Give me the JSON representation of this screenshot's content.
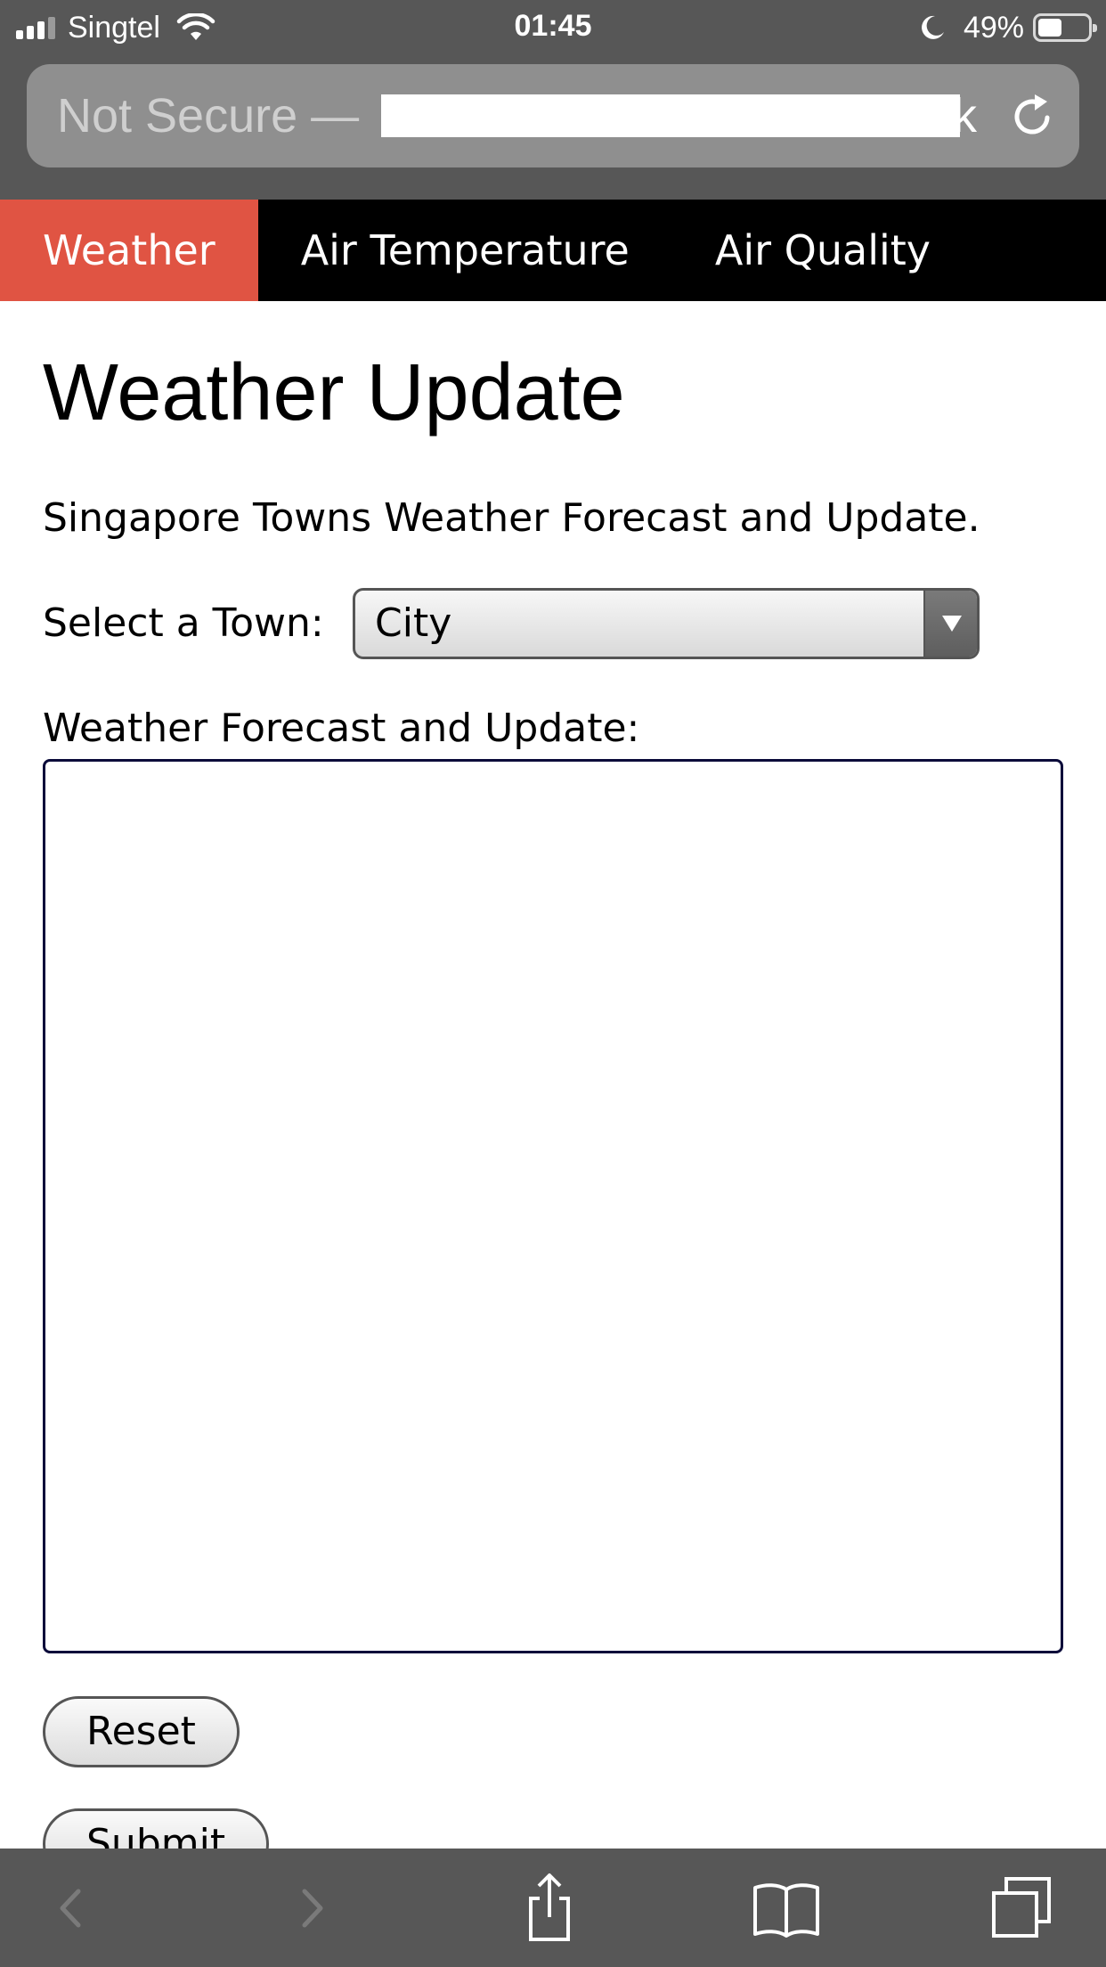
{
  "status_bar": {
    "carrier": "Singtel",
    "time": "01:45",
    "battery_percent_text": "49%",
    "battery_level": 0.49
  },
  "browser": {
    "url_prefix": "Not Secure —",
    "url_suffix": "k"
  },
  "nav": {
    "items": [
      {
        "label": "Weather",
        "active": true
      },
      {
        "label": "Air Temperature",
        "active": false
      },
      {
        "label": "Air Quality",
        "active": false
      }
    ]
  },
  "main": {
    "title": "Weather Update",
    "intro": "Singapore Towns Weather Forecast and Update.",
    "town_label": "Select a Town:",
    "town_selected": "City",
    "forecast_label": "Weather Forecast and Update:",
    "forecast_value": "",
    "reset_label": "Reset",
    "submit_label": "Submit"
  },
  "colors": {
    "nav_active": "#e05443",
    "nav_background": "#000000",
    "browser_chrome": "#575757"
  },
  "toolbar": {
    "icons": [
      "back-arrow-icon",
      "forward-arrow-icon",
      "share-icon",
      "bookmarks-icon",
      "tabs-icon"
    ]
  }
}
